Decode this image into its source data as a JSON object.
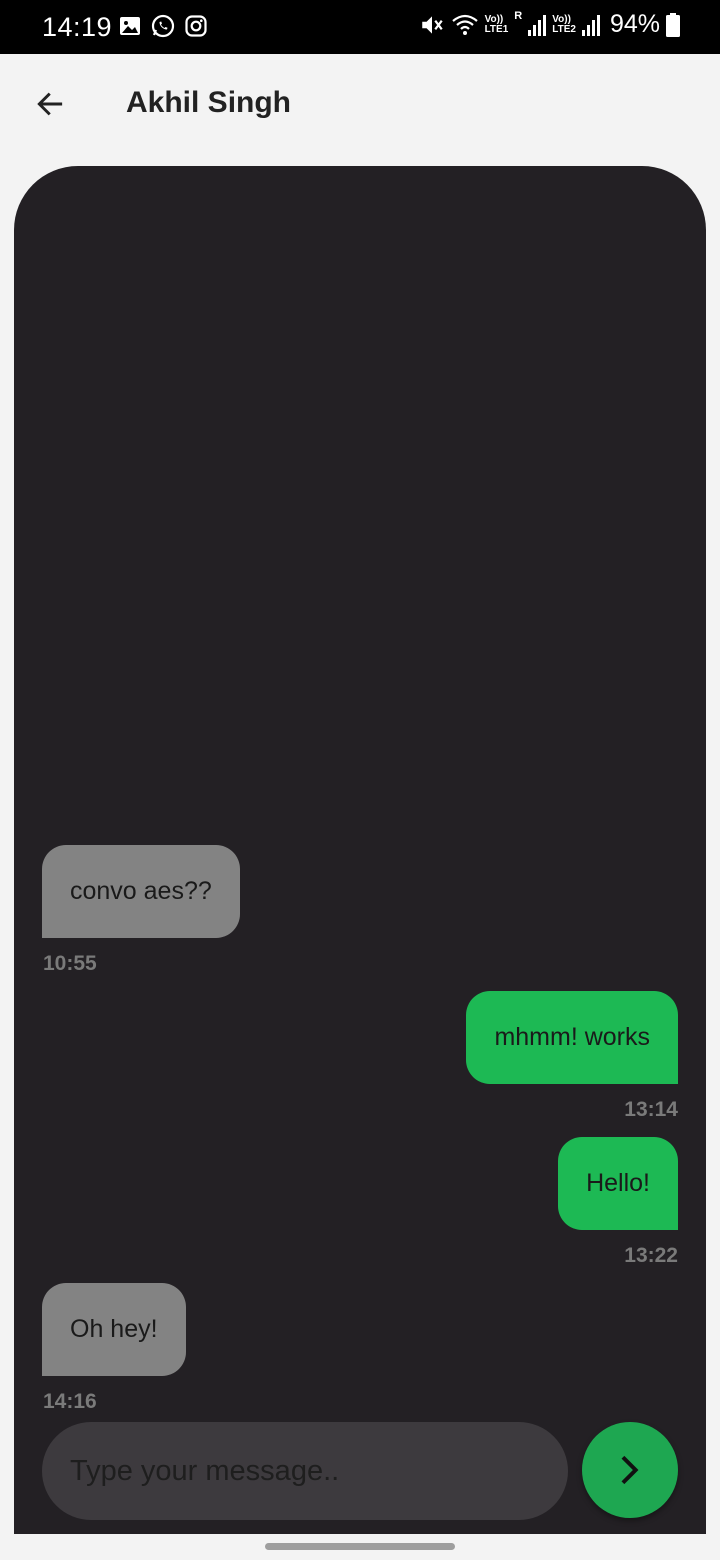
{
  "status_bar": {
    "time": "14:19",
    "battery": "94%",
    "sim1": "LTE1",
    "sim2": "LTE2",
    "roaming": "R",
    "volte": "Vo))",
    "icons": [
      "gallery-icon",
      "whatsapp-icon",
      "instagram-icon",
      "mute-icon",
      "wifi-icon",
      "signal-icon",
      "battery-icon"
    ]
  },
  "header": {
    "title": "Akhil Singh",
    "back_icon": "arrow-left-icon"
  },
  "messages": [
    {
      "direction": "incoming",
      "text": "convo aes??",
      "time": "10:55"
    },
    {
      "direction": "outgoing",
      "text": "mhmm! works",
      "time": "13:14"
    },
    {
      "direction": "outgoing",
      "text": "Hello!",
      "time": "13:22"
    },
    {
      "direction": "incoming",
      "text": "Oh hey!",
      "time": "14:16"
    }
  ],
  "composer": {
    "placeholder": "Type your message..",
    "value": "",
    "send_icon": "chevron-right-icon"
  },
  "colors": {
    "chat_background": "#232024",
    "incoming_bubble": "#838383",
    "outgoing_bubble": "#1db954",
    "send_button": "#1ea751",
    "timestamp": "#7a7a7a"
  }
}
